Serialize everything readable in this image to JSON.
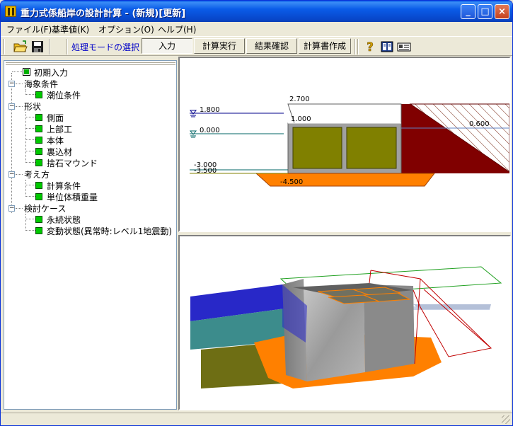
{
  "window": {
    "title": "重力式係船岸の設計計算 - (新規)[更新]",
    "controls": {
      "minimize": "_",
      "maximize": "□",
      "close": "×"
    }
  },
  "menu": [
    {
      "label": "ファイル(F)"
    },
    {
      "label": "基準値(K)"
    },
    {
      "label": "オプション(O)"
    },
    {
      "label": "ヘルプ(H)"
    }
  ],
  "toolbar": {
    "icons": [
      "open-folder-icon",
      "save-disk-icon",
      "help-icon",
      "book-icon",
      "card-icon"
    ],
    "mode_label": "処理モードの選択",
    "modes": [
      {
        "label": "入力",
        "active": true
      },
      {
        "label": "計算実行",
        "active": false
      },
      {
        "label": "結果確認",
        "active": false
      },
      {
        "label": "計算書作成",
        "active": false
      }
    ]
  },
  "tree": {
    "root": {
      "label": "初期入力",
      "checked": true
    },
    "groups": [
      {
        "label": "海象条件",
        "expander": "−",
        "items": [
          "潮位条件"
        ]
      },
      {
        "label": "形状",
        "expander": "−",
        "items": [
          "側面",
          "上部工",
          "本体",
          "裏込材",
          "捨石マウンド"
        ]
      },
      {
        "label": "考え方",
        "expander": "−",
        "items": [
          "計算条件",
          "単位体積重量"
        ]
      },
      {
        "label": "検討ケース",
        "expander": "−",
        "items": [
          "永続状態",
          "変動状態(異常時:レベル1地震動)"
        ]
      }
    ]
  },
  "section_view": {
    "water_levels": [
      "1.800",
      "0.000",
      "-3.000",
      "-3.500"
    ],
    "labels": {
      "top_elev": "2.700",
      "cap_elev": "1.000",
      "mound_bottom": "-4.500",
      "backfill_level": "0.600"
    },
    "colors": {
      "hwl_line": "#00008b",
      "lwl_line": "#006464",
      "caisson": "#808000",
      "caisson_frame": "#a0a0a0",
      "mound": "#ff8000",
      "backfill": "#800000",
      "hatch": "#808040"
    }
  },
  "perspective_view": {
    "colors": {
      "sea_upper": "#2828c8",
      "sea_lower": "#3c8c8c",
      "seabed": "#6e6e14",
      "mound": "#ff8000",
      "concrete": "#a0a0a0",
      "backfill_outline": "#c00000",
      "plane_outline": "#20a020",
      "plane_fill": "#c8d2e6"
    }
  }
}
